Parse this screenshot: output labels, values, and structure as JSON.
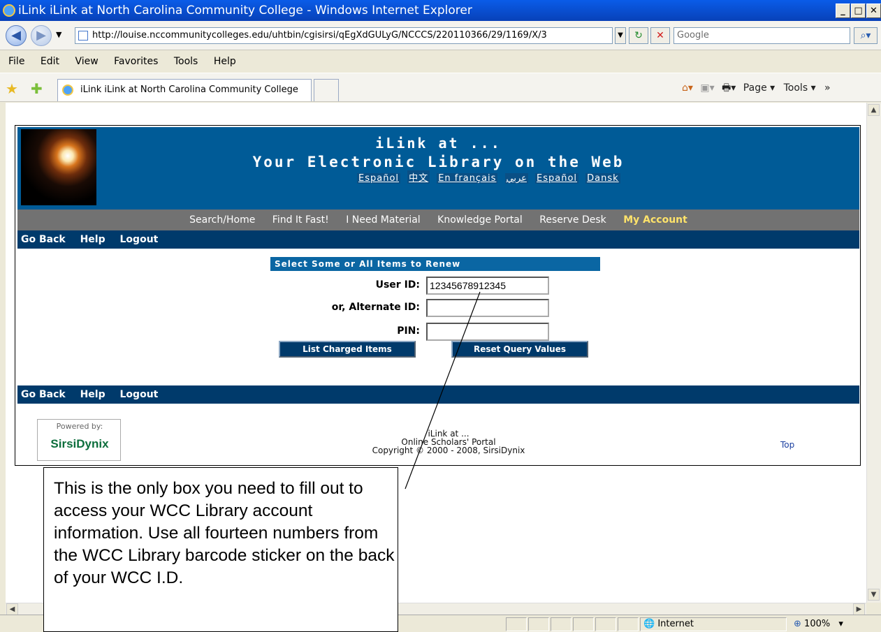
{
  "window": {
    "title": "iLink iLink at North Carolina Community College - Windows Internet Explorer",
    "min": "_",
    "max": "□",
    "close": "✕"
  },
  "address_bar": {
    "url": "http://louise.nccommunitycolleges.edu/uhtbin/cgisirsi/qEgXdGULyG/NCCCS/220110366/29/1169/X/3"
  },
  "search": {
    "placeholder": "Google"
  },
  "menu": [
    "File",
    "Edit",
    "View",
    "Favorites",
    "Tools",
    "Help"
  ],
  "tabs": {
    "active": "iLink iLink at North Carolina Community College"
  },
  "command_bar": {
    "page": "Page ▾",
    "tools": "Tools ▾"
  },
  "banner": {
    "line1": "iLink at ...",
    "line2": "Your Electronic Library on the Web",
    "languages": [
      "Español",
      "中文",
      "En français",
      "عربي",
      "Español",
      "Dansk"
    ]
  },
  "nav": {
    "items": [
      "Search/Home",
      "Find It Fast!",
      "I Need Material",
      "Knowledge Portal",
      "Reserve Desk",
      "My Account"
    ]
  },
  "subnav": {
    "back": "Go Back",
    "help": "Help",
    "logout": "Logout"
  },
  "form": {
    "header": "Select Some or All Items to Renew",
    "user_id_label": "User ID:",
    "user_id_value": "12345678912345",
    "alt_id_label": "or,  Alternate ID:",
    "alt_id_value": "",
    "pin_label": "PIN:",
    "pin_value": "",
    "list_button": "List Charged Items",
    "reset_button": "Reset Query Values"
  },
  "footer": {
    "powered": "Powered by:",
    "logo": "SirsiDynix",
    "line1": "iLink at ...",
    "line2": "Online Scholars' Portal",
    "line3": "Copyright © 2000 - 2008, SirsiDynix",
    "top": "Top"
  },
  "callout": {
    "text": "This is the only box you need to fill out to access your WCC Library account information. Use all fourteen numbers from the WCC Library barcode sticker on the back of your WCC I.D."
  },
  "status": {
    "zone": "Internet",
    "zoom": "100%"
  }
}
